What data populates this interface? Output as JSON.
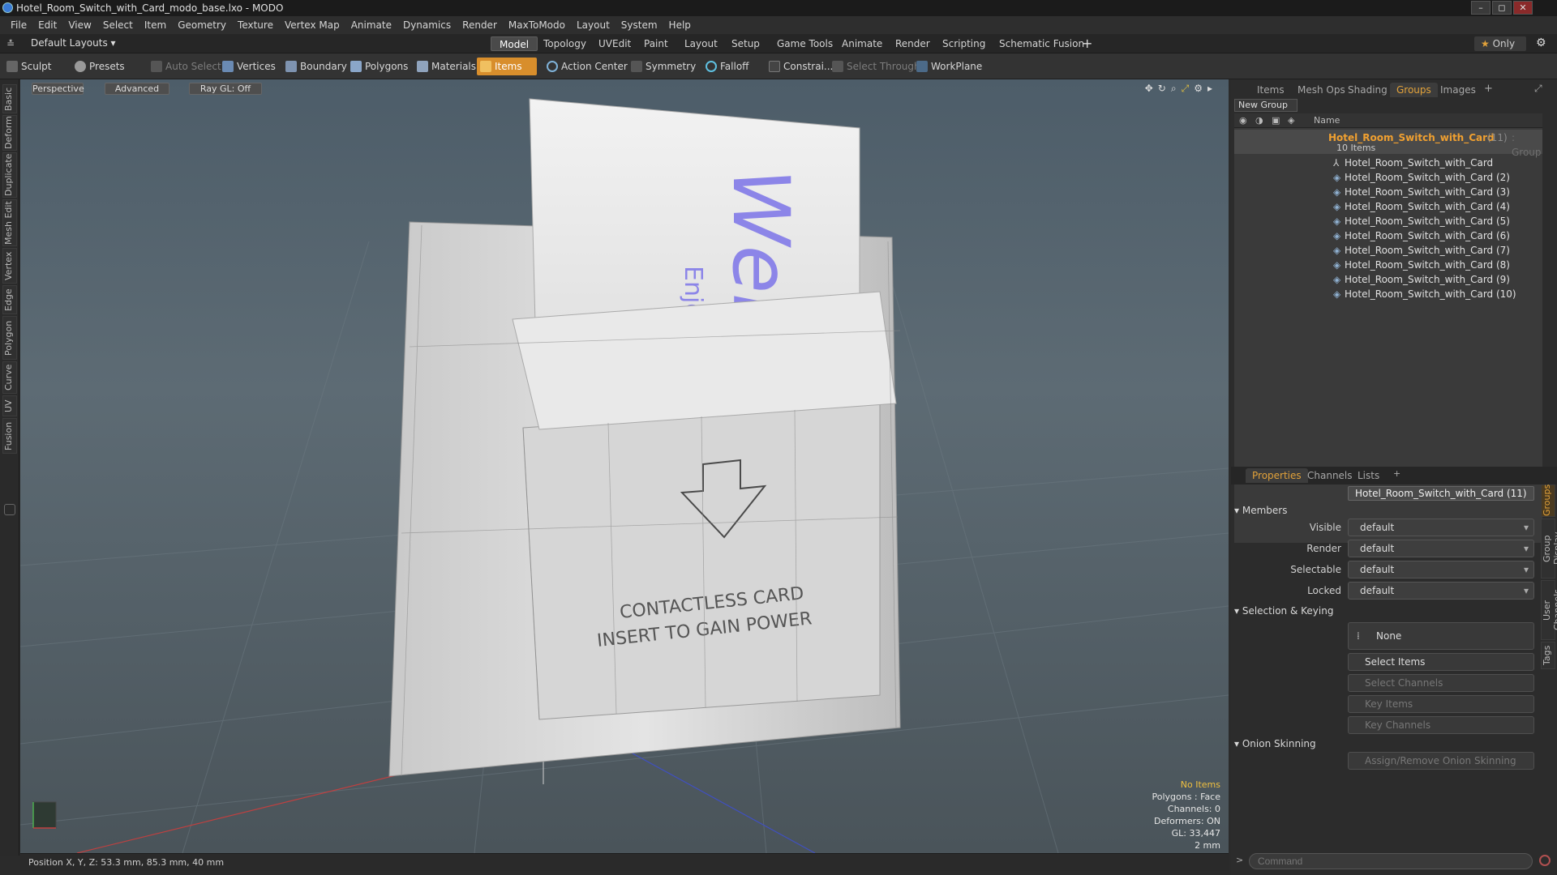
{
  "window": {
    "title": "Hotel_Room_Switch_with_Card_modo_base.lxo - MODO",
    "controls": [
      "–",
      "◻",
      "✕"
    ]
  },
  "menu": [
    "File",
    "Edit",
    "View",
    "Select",
    "Item",
    "Geometry",
    "Texture",
    "Vertex Map",
    "Animate",
    "Dynamics",
    "Render",
    "MaxToModo",
    "Layout",
    "System",
    "Help"
  ],
  "layout_bar": {
    "layout_dropdown": "Default Layouts",
    "tabs": [
      "Model",
      "Topology",
      "UVEdit",
      "Paint",
      "Layout",
      "Setup",
      "Game Tools",
      "Animate",
      "Render",
      "Scripting",
      "Schematic Fusion"
    ],
    "active_tab": "Model",
    "only_label": "Only"
  },
  "toolbar": {
    "sculpt": "Sculpt",
    "presets": "Presets",
    "auto_select": "Auto Select",
    "vertices": "Vertices",
    "boundary": "Boundary",
    "polygons": "Polygons",
    "materials": "Materials",
    "items": "Items",
    "action_center": "Action Center",
    "symmetry": "Symmetry",
    "falloff": "Falloff",
    "constraints": "Constrai...",
    "select_through": "Select Through",
    "workplane": "WorkPlane"
  },
  "left_tabs": [
    "Basic",
    "Deform",
    "Duplicate",
    "Mesh Edit",
    "Vertex",
    "Edge",
    "Polygon",
    "Curve",
    "UV",
    "Fusion"
  ],
  "viewport": {
    "view_mode": "Perspective",
    "advanced": "Advanced",
    "raygl": "Ray GL: Off",
    "model_text": {
      "card_big": "Welc",
      "card_small": "Enjoy you",
      "slot_line1": "CONTACTLESS CARD",
      "slot_line2": "INSERT TO GAIN POWER"
    },
    "hud": {
      "items": "No Items",
      "polygons": "Polygons : Face",
      "channels": "Channels: 0",
      "deformers": "Deformers: ON",
      "gl": "GL: 33,447",
      "scale": "2 mm"
    }
  },
  "status_bar": {
    "position": "Position X, Y, Z:   53.3 mm, 85.3 mm, 40 mm"
  },
  "right_panel": {
    "top_tabs": [
      "Items",
      "Mesh Ops",
      "Shading",
      "Groups",
      "Images"
    ],
    "active_top_tab": "Groups",
    "new_group": "New Group",
    "name_header": "Name",
    "group": {
      "name": "Hotel_Room_Switch_with_Card",
      "count": "(11)",
      "type": ": Group",
      "item_count": "10 Items"
    },
    "items": [
      "Hotel_Room_Switch_with_Card",
      "Hotel_Room_Switch_with_Card (2)",
      "Hotel_Room_Switch_with_Card (3)",
      "Hotel_Room_Switch_with_Card (4)",
      "Hotel_Room_Switch_with_Card (5)",
      "Hotel_Room_Switch_with_Card (6)",
      "Hotel_Room_Switch_with_Card (7)",
      "Hotel_Room_Switch_with_Card (8)",
      "Hotel_Room_Switch_with_Card (9)",
      "Hotel_Room_Switch_with_Card (10)"
    ],
    "props_tabs": [
      "Properties",
      "Channels",
      "Lists"
    ],
    "active_props_tab": "Properties",
    "name_label": "Name",
    "name_value": "Hotel_Room_Switch_with_Card (11)",
    "members_section": "Members",
    "visible_label": "Visible",
    "visible_value": "default",
    "render_label": "Render",
    "render_value": "default",
    "selectable_label": "Selectable",
    "selectable_value": "default",
    "locked_label": "Locked",
    "locked_value": "default",
    "selection_section": "Selection & Keying",
    "none_button": "None",
    "select_items": "Select Items",
    "select_channels": "Select Channels",
    "key_items": "Key Items",
    "key_channels": "Key Channels",
    "onion_section": "Onion Skinning",
    "onion_button": "Assign/Remove Onion Skinning",
    "side_tabs": [
      "Groups",
      "Group Display",
      "User Channels",
      "Tags"
    ],
    "command_placeholder": "Command"
  },
  "colors": {
    "accent": "#e2a23a",
    "items_active": "#d88e2c",
    "card_text": "#8c85e8"
  }
}
